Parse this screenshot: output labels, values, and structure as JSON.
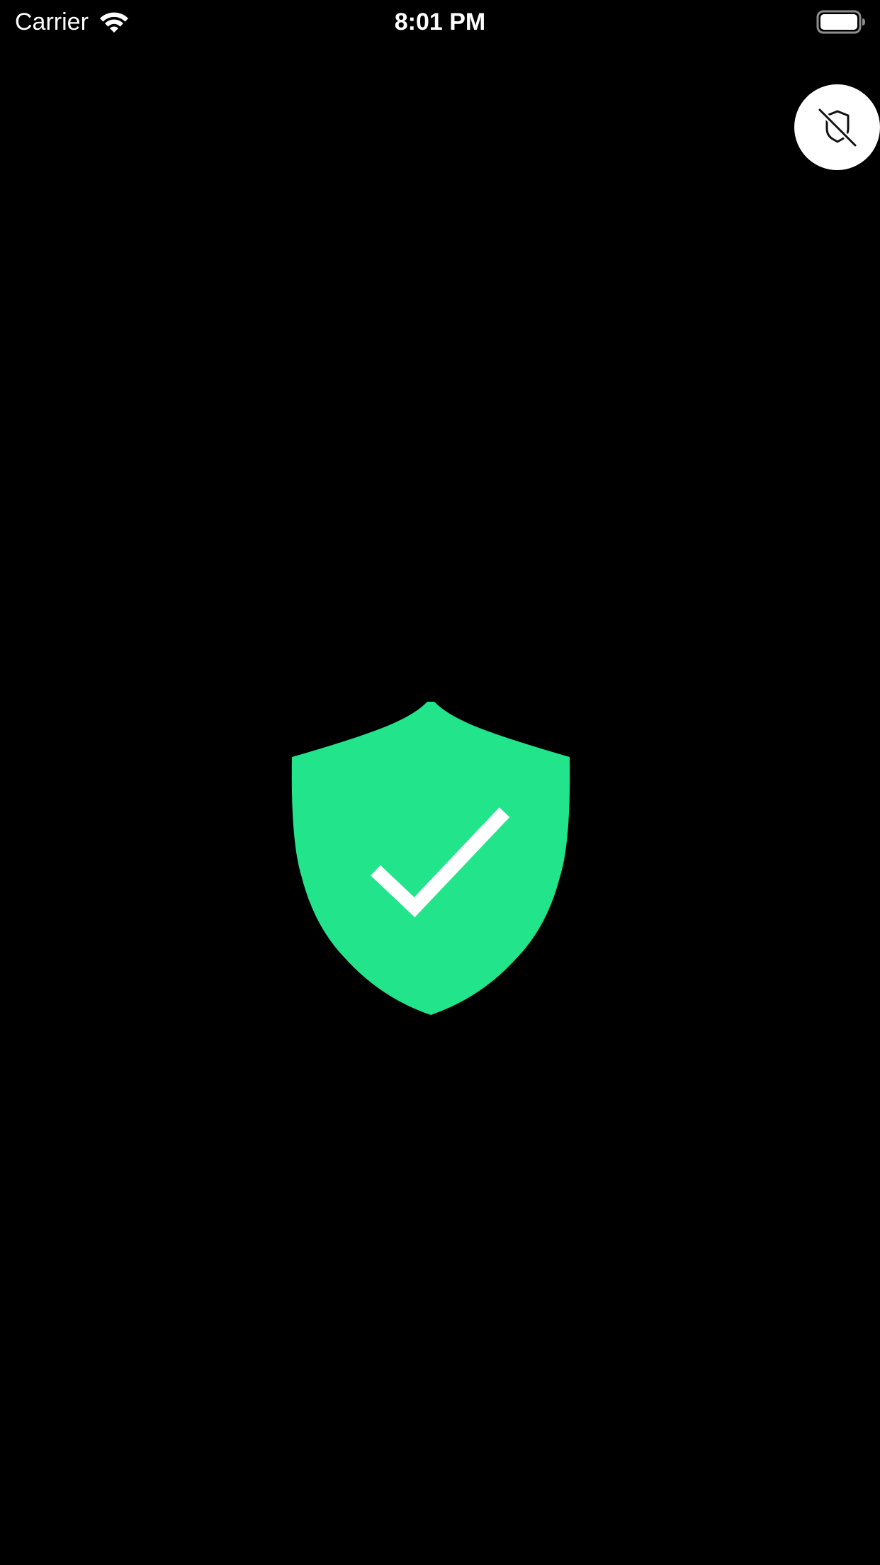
{
  "status_bar": {
    "carrier": "Carrier",
    "time": "8:01 PM",
    "wifi_icon": "wifi-icon",
    "battery_icon": "battery-icon",
    "battery_level": 1.0
  },
  "privacy_toggle": {
    "icon": "shield-slash-icon",
    "background": "#ffffff",
    "icon_color": "#111111"
  },
  "main": {
    "status_icon": "shield-check-icon",
    "shield_color": "#22E58B",
    "check_color": "#ffffff",
    "background": "#000000"
  }
}
